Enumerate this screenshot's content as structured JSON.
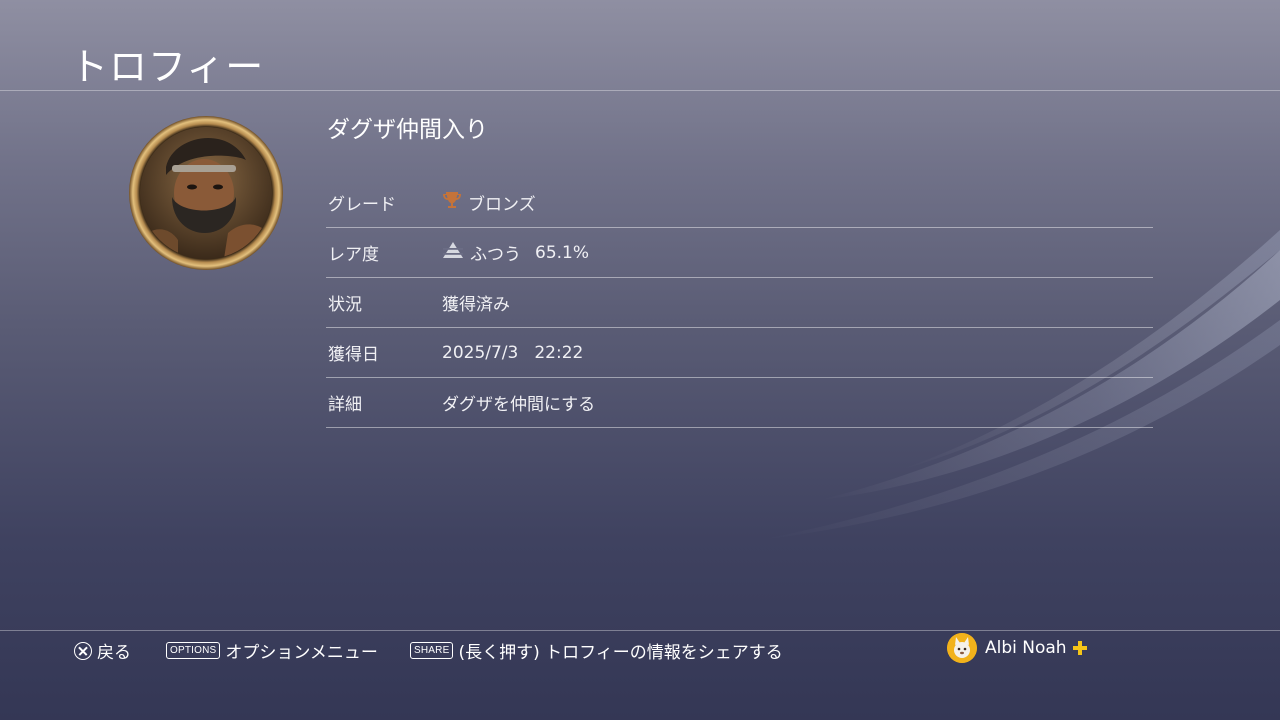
{
  "header": {
    "title": "トロフィー"
  },
  "trophy": {
    "name": "ダグザ仲間入り",
    "rows": {
      "grade": {
        "label": "グレード",
        "value": "ブロンズ"
      },
      "rarity": {
        "label": "レア度",
        "value": "ふつう",
        "percent": "65.1%"
      },
      "status": {
        "label": "状況",
        "value": "獲得済み"
      },
      "earned": {
        "label": "獲得日",
        "date": "2025/7/3",
        "time": "22:22"
      },
      "detail": {
        "label": "詳細",
        "value": "ダグザを仲間にする"
      }
    }
  },
  "footer": {
    "back_label": "戻る",
    "options_button": "OPTIONS",
    "options_label": "オプションメニュー",
    "share_button": "SHARE",
    "share_label": "(長く押す) トロフィーの情報をシェアする",
    "username": "Albi Noah"
  },
  "icons": {
    "grade": "bronze-trophy-icon",
    "rarity": "rarity-pyramid-icon",
    "back": "cross-button-icon",
    "plus": "ps-plus-icon"
  },
  "colors": {
    "bronze": "#c4733a",
    "plus_gold": "#f5c518",
    "avatar_bg": "#f2b21b"
  }
}
